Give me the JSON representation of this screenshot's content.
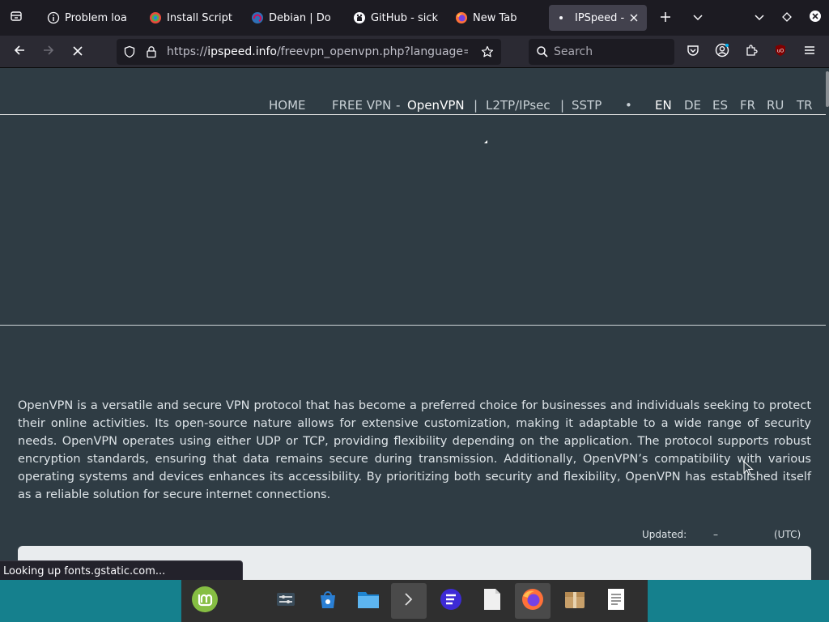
{
  "browser": {
    "tabs": [
      {
        "title": "Problem loa",
        "icon": "info-icon"
      },
      {
        "title": "Install Script",
        "icon": "script-favicon"
      },
      {
        "title": "Debian | Do",
        "icon": "debian-favicon"
      },
      {
        "title": "GitHub - sick",
        "icon": "github-icon"
      },
      {
        "title": "New Tab",
        "icon": "firefox-icon"
      },
      {
        "title": "IPSpeed -",
        "icon": "loading-dot-icon",
        "active": true
      }
    ],
    "url": {
      "scheme": "https://",
      "host": "ipspeed.info",
      "path": "/freevpn_openvpn.php?language=en"
    },
    "search_placeholder": "Search"
  },
  "site": {
    "nav": {
      "home": "HOME",
      "free_vpn": "FREE VPN",
      "dash": "-",
      "openvpn": "OpenVPN",
      "sep1": "|",
      "l2tp": "L2TP/IPsec",
      "sep2": "|",
      "sstp": "SSTP",
      "bullet": "•",
      "languages": [
        "EN",
        "DE",
        "ES",
        "FR",
        "RU",
        "TR"
      ]
    },
    "intro": "OpenVPN is a versatile and secure VPN protocol that has become a preferred choice for businesses and individuals seeking to protect their online activities. Its open-source nature allows for extensive customization, making it adaptable to a wide range of security needs. OpenVPN operates using either UDP or TCP, providing flexibility depending on the application. The protocol supports robust encryption standards, ensuring that data remains secure during transmission. Additionally, OpenVPN’s compatibility with various operating systems and devices enhances its accessibility. By prioritizing both security and flexibility, OpenVPN has established itself as a reliable solution for secure internet connections.",
    "updated": {
      "label": "Updated:",
      "value": "–",
      "tz": "(UTC)"
    }
  },
  "status": "Looking up fonts.gstatic.com...",
  "taskbar": {
    "apps": [
      "mint-menu-icon",
      "settings-icon",
      "software-store-icon",
      "files-icon",
      "terminal-icon",
      "app-icon",
      "text-file-icon",
      "firefox-icon",
      "archive-icon",
      "document-icon"
    ]
  },
  "colors": {
    "accent_tab": "#42414d",
    "page_bg": "#2f3c44",
    "taskbar_teal": "#15808d"
  }
}
